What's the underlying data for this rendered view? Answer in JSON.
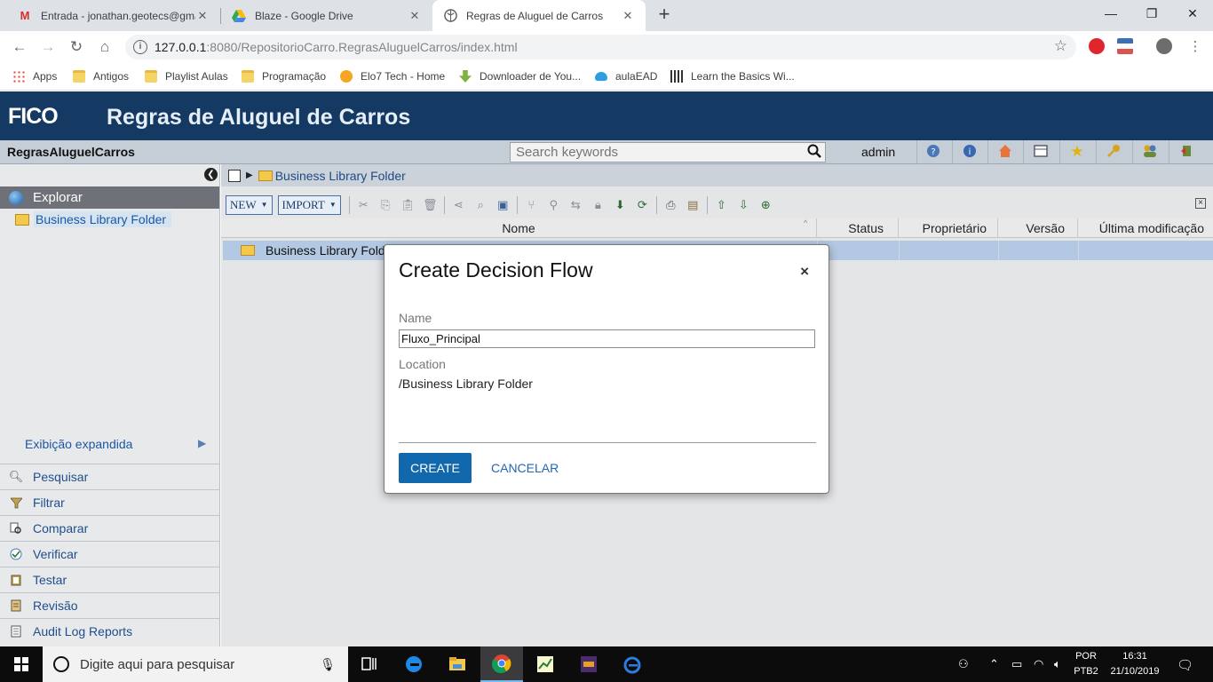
{
  "browser": {
    "tabs": [
      {
        "title": "Entrada - jonathan.geotecs@gmail.com",
        "icon": "gmail-icon"
      },
      {
        "title": "Blaze - Google Drive",
        "icon": "google-drive-icon"
      },
      {
        "title": "Regras de Aluguel de Carros",
        "icon": "globe-icon"
      }
    ],
    "url_host": "127.0.0.1",
    "url_rest": ":8080/RepositorioCarro.RegrasAluguelCarros/index.html",
    "bookmarks": [
      {
        "label": "Apps",
        "icon": "apps-grid-icon"
      },
      {
        "label": "Antigos",
        "icon": "folder-icon"
      },
      {
        "label": "Playlist Aulas",
        "icon": "folder-icon"
      },
      {
        "label": "Programação",
        "icon": "folder-icon"
      },
      {
        "label": "Elo7 Tech - Home",
        "icon": "elo7-icon"
      },
      {
        "label": "Downloader de You...",
        "icon": "download-icon"
      },
      {
        "label": "aulaEAD",
        "icon": "cloud-icon"
      },
      {
        "label": "Learn the Basics Wi...",
        "icon": "learn-icon"
      }
    ]
  },
  "app": {
    "logo": "FICO",
    "title": "Regras de Aluguel de Carros",
    "project": "RegrasAluguelCarros",
    "search_placeholder": "Search keywords",
    "user": "admin",
    "breadcrumb": "Business Library Folder"
  },
  "left_panel": {
    "explorer_label": "Explorar",
    "tree_item": "Business Library Folder",
    "expanded_view": "Exibição expandida",
    "nav_items": [
      {
        "label": "Pesquisar",
        "icon": "magnifier-icon"
      },
      {
        "label": "Filtrar",
        "icon": "filter-icon"
      },
      {
        "label": "Comparar",
        "icon": "compare-icon"
      },
      {
        "label": "Verificar",
        "icon": "check-icon"
      },
      {
        "label": "Testar",
        "icon": "clipboard-icon"
      },
      {
        "label": "Revisão",
        "icon": "review-icon"
      },
      {
        "label": "Audit Log Reports",
        "icon": "report-icon"
      }
    ]
  },
  "toolbar": {
    "new_label": "NEW",
    "import_label": "IMPORT"
  },
  "grid": {
    "columns": [
      "Nome",
      "Status",
      "Proprietário",
      "Versão",
      "Última modificação"
    ],
    "rows": [
      {
        "name": "Business Library Folder"
      }
    ]
  },
  "modal": {
    "title": "Create Decision Flow",
    "close": "×",
    "name_label": "Name",
    "name_value": "Fluxo_Principal",
    "location_label": "Location",
    "location_value": "/Business Library Folder",
    "create_label": "CREATE",
    "cancel_label": "CANCELAR"
  },
  "taskbar": {
    "search_placeholder": "Digite aqui para pesquisar",
    "lang_top": "POR",
    "lang_bottom": "PTB2",
    "time": "16:31",
    "date": "21/10/2019"
  },
  "colors": {
    "app_header": "#143a63",
    "create_button": "#1268ad",
    "selected_row": "#b3c8e2"
  }
}
